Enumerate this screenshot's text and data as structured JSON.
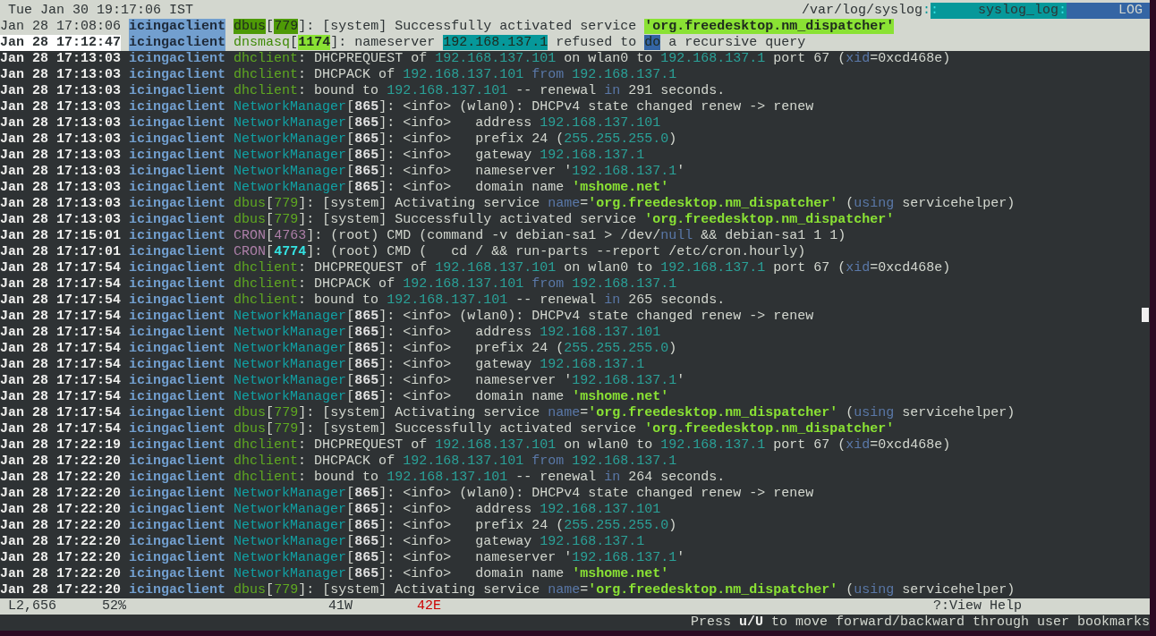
{
  "top_bar": {
    "clock": "Tue Jan 30 19:17:06 IST",
    "file_path": "/var/log/syslog",
    "separators": [
      ":",
      ":",
      ":"
    ],
    "format": "syslog_log",
    "view": "LOG"
  },
  "lines": [
    {
      "time": "Jan 28 17:08:06",
      "host": "icingaclient",
      "inverse": true,
      "selected": false,
      "segments": [
        {
          "kind": "green",
          "text": "dbus"
        },
        {
          "kind": "plain",
          "text": "["
        },
        {
          "kind": "green",
          "text": "779"
        },
        {
          "kind": "plain",
          "text": "]: [system] Successfully activated service "
        },
        {
          "kind": "string",
          "text": "'org.freedesktop.nm_dispatcher'"
        }
      ]
    },
    {
      "time": "Jan 28 17:12:47",
      "host": "icingaclient",
      "inverse": true,
      "selected": true,
      "segments": [
        {
          "kind": "green",
          "text": "dnsmasq"
        },
        {
          "kind": "plain",
          "text": "["
        },
        {
          "kind": "bright",
          "text": "1174"
        },
        {
          "kind": "plain",
          "text": "]: nameserver "
        },
        {
          "kind": "ip",
          "text": "192.168.137.1"
        },
        {
          "kind": "plain",
          "text": " refused to "
        },
        {
          "kind": "match",
          "text": "do"
        },
        {
          "kind": "plain",
          "text": " a recursive query"
        }
      ]
    },
    {
      "time": "Jan 28 17:13:03",
      "host": "icingaclient",
      "inverse": false,
      "selected": false,
      "segments": [
        {
          "kind": "green",
          "text": "dhclient"
        },
        {
          "kind": "plain",
          "text": ": DHCPREQUEST of "
        },
        {
          "kind": "ip",
          "text": "192.168.137.101"
        },
        {
          "kind": "plain",
          "text": " on wlan0 to "
        },
        {
          "kind": "ip",
          "text": "192.168.137.1"
        },
        {
          "kind": "plain",
          "text": " port 67 ("
        },
        {
          "kind": "keyword",
          "text": "xid"
        },
        {
          "kind": "plain",
          "text": "=0xcd468e)"
        }
      ]
    },
    {
      "time": "Jan 28 17:13:03",
      "host": "icingaclient",
      "inverse": false,
      "selected": false,
      "segments": [
        {
          "kind": "green",
          "text": "dhclient"
        },
        {
          "kind": "plain",
          "text": ": DHCPACK of "
        },
        {
          "kind": "ip",
          "text": "192.168.137.101"
        },
        {
          "kind": "keyword",
          "text": " from "
        },
        {
          "kind": "ip",
          "text": "192.168.137.1"
        }
      ]
    },
    {
      "time": "Jan 28 17:13:03",
      "host": "icingaclient",
      "inverse": false,
      "selected": false,
      "segments": [
        {
          "kind": "green",
          "text": "dhclient"
        },
        {
          "kind": "plain",
          "text": ": bound to "
        },
        {
          "kind": "ip",
          "text": "192.168.137.101"
        },
        {
          "kind": "plain",
          "text": " -- renewal "
        },
        {
          "kind": "keyword",
          "text": "in"
        },
        {
          "kind": "plain",
          "text": " 291 seconds."
        }
      ]
    },
    {
      "time": "Jan 28 17:13:03",
      "host": "icingaclient",
      "inverse": false,
      "selected": false,
      "segments": [
        {
          "kind": "teal",
          "text": "NetworkManager"
        },
        {
          "kind": "plain",
          "text": "["
        },
        {
          "kind": "bold",
          "text": "865"
        },
        {
          "kind": "plain",
          "text": "]: <info> (wlan0): DHCPv4 state changed renew -> renew"
        }
      ]
    },
    {
      "time": "Jan 28 17:13:03",
      "host": "icingaclient",
      "inverse": false,
      "selected": false,
      "segments": [
        {
          "kind": "teal",
          "text": "NetworkManager"
        },
        {
          "kind": "plain",
          "text": "["
        },
        {
          "kind": "bold",
          "text": "865"
        },
        {
          "kind": "plain",
          "text": "]: <info>   address "
        },
        {
          "kind": "ip",
          "text": "192.168.137.101"
        }
      ]
    },
    {
      "time": "Jan 28 17:13:03",
      "host": "icingaclient",
      "inverse": false,
      "selected": false,
      "segments": [
        {
          "kind": "teal",
          "text": "NetworkManager"
        },
        {
          "kind": "plain",
          "text": "["
        },
        {
          "kind": "bold",
          "text": "865"
        },
        {
          "kind": "plain",
          "text": "]: <info>   prefix 24 ("
        },
        {
          "kind": "ip",
          "text": "255.255.255.0"
        },
        {
          "kind": "plain",
          "text": ")"
        }
      ]
    },
    {
      "time": "Jan 28 17:13:03",
      "host": "icingaclient",
      "inverse": false,
      "selected": false,
      "segments": [
        {
          "kind": "teal",
          "text": "NetworkManager"
        },
        {
          "kind": "plain",
          "text": "["
        },
        {
          "kind": "bold",
          "text": "865"
        },
        {
          "kind": "plain",
          "text": "]: <info>   gateway "
        },
        {
          "kind": "ip",
          "text": "192.168.137.1"
        }
      ]
    },
    {
      "time": "Jan 28 17:13:03",
      "host": "icingaclient",
      "inverse": false,
      "selected": false,
      "segments": [
        {
          "kind": "teal",
          "text": "NetworkManager"
        },
        {
          "kind": "plain",
          "text": "["
        },
        {
          "kind": "bold",
          "text": "865"
        },
        {
          "kind": "plain",
          "text": "]: <info>   nameserver '"
        },
        {
          "kind": "ip",
          "text": "192.168.137.1"
        },
        {
          "kind": "plain",
          "text": "'"
        }
      ]
    },
    {
      "time": "Jan 28 17:13:03",
      "host": "icingaclient",
      "inverse": false,
      "selected": false,
      "segments": [
        {
          "kind": "teal",
          "text": "NetworkManager"
        },
        {
          "kind": "plain",
          "text": "["
        },
        {
          "kind": "bold",
          "text": "865"
        },
        {
          "kind": "plain",
          "text": "]: <info>   domain name "
        },
        {
          "kind": "string",
          "text": "'mshome.net'"
        }
      ]
    },
    {
      "time": "Jan 28 17:13:03",
      "host": "icingaclient",
      "inverse": false,
      "selected": false,
      "segments": [
        {
          "kind": "green",
          "text": "dbus"
        },
        {
          "kind": "plain",
          "text": "["
        },
        {
          "kind": "green",
          "text": "779"
        },
        {
          "kind": "plain",
          "text": "]: [system] Activating service "
        },
        {
          "kind": "keyword",
          "text": "name"
        },
        {
          "kind": "plain",
          "text": "="
        },
        {
          "kind": "string",
          "text": "'org.freedesktop.nm_dispatcher'"
        },
        {
          "kind": "plain",
          "text": " ("
        },
        {
          "kind": "keyword",
          "text": "using"
        },
        {
          "kind": "plain",
          "text": " servicehelper)"
        }
      ]
    },
    {
      "time": "Jan 28 17:13:03",
      "host": "icingaclient",
      "inverse": false,
      "selected": false,
      "segments": [
        {
          "kind": "green",
          "text": "dbus"
        },
        {
          "kind": "plain",
          "text": "["
        },
        {
          "kind": "green",
          "text": "779"
        },
        {
          "kind": "plain",
          "text": "]: [system] Successfully activated service "
        },
        {
          "kind": "string",
          "text": "'org.freedesktop.nm_dispatcher'"
        }
      ]
    },
    {
      "time": "Jan 28 17:15:01",
      "host": "icingaclient",
      "inverse": false,
      "selected": false,
      "segments": [
        {
          "kind": "pink",
          "text": "CRON"
        },
        {
          "kind": "plain",
          "text": "["
        },
        {
          "kind": "pink",
          "text": "4763"
        },
        {
          "kind": "plain",
          "text": "]: (root) CMD (command -v debian-sa1 > /dev/"
        },
        {
          "kind": "keyword",
          "text": "null"
        },
        {
          "kind": "plain",
          "text": " && debian-sa1 1 1)"
        }
      ]
    },
    {
      "time": "Jan 28 17:17:01",
      "host": "icingaclient",
      "inverse": false,
      "selected": false,
      "segments": [
        {
          "kind": "pink",
          "text": "CRON"
        },
        {
          "kind": "plain",
          "text": "["
        },
        {
          "kind": "cyan",
          "text": "4774"
        },
        {
          "kind": "plain",
          "text": "]: (root) CMD (   cd / && run-parts --report /etc/cron.hourly)"
        }
      ]
    },
    {
      "time": "Jan 28 17:17:54",
      "host": "icingaclient",
      "inverse": false,
      "selected": false,
      "segments": [
        {
          "kind": "green",
          "text": "dhclient"
        },
        {
          "kind": "plain",
          "text": ": DHCPREQUEST of "
        },
        {
          "kind": "ip",
          "text": "192.168.137.101"
        },
        {
          "kind": "plain",
          "text": " on wlan0 to "
        },
        {
          "kind": "ip",
          "text": "192.168.137.1"
        },
        {
          "kind": "plain",
          "text": " port 67 ("
        },
        {
          "kind": "keyword",
          "text": "xid"
        },
        {
          "kind": "plain",
          "text": "=0xcd468e)"
        }
      ]
    },
    {
      "time": "Jan 28 17:17:54",
      "host": "icingaclient",
      "inverse": false,
      "selected": false,
      "segments": [
        {
          "kind": "green",
          "text": "dhclient"
        },
        {
          "kind": "plain",
          "text": ": DHCPACK of "
        },
        {
          "kind": "ip",
          "text": "192.168.137.101"
        },
        {
          "kind": "keyword",
          "text": " from "
        },
        {
          "kind": "ip",
          "text": "192.168.137.1"
        }
      ]
    },
    {
      "time": "Jan 28 17:17:54",
      "host": "icingaclient",
      "inverse": false,
      "selected": false,
      "segments": [
        {
          "kind": "green",
          "text": "dhclient"
        },
        {
          "kind": "plain",
          "text": ": bound to "
        },
        {
          "kind": "ip",
          "text": "192.168.137.101"
        },
        {
          "kind": "plain",
          "text": " -- renewal "
        },
        {
          "kind": "keyword",
          "text": "in"
        },
        {
          "kind": "plain",
          "text": " 265 seconds."
        }
      ]
    },
    {
      "time": "Jan 28 17:17:54",
      "host": "icingaclient",
      "inverse": false,
      "selected": false,
      "segments": [
        {
          "kind": "teal",
          "text": "NetworkManager"
        },
        {
          "kind": "plain",
          "text": "["
        },
        {
          "kind": "bold",
          "text": "865"
        },
        {
          "kind": "plain",
          "text": "]: <info> (wlan0): DHCPv4 state changed renew -> renew"
        }
      ]
    },
    {
      "time": "Jan 28 17:17:54",
      "host": "icingaclient",
      "inverse": false,
      "selected": false,
      "segments": [
        {
          "kind": "teal",
          "text": "NetworkManager"
        },
        {
          "kind": "plain",
          "text": "["
        },
        {
          "kind": "bold",
          "text": "865"
        },
        {
          "kind": "plain",
          "text": "]: <info>   address "
        },
        {
          "kind": "ip",
          "text": "192.168.137.101"
        }
      ]
    },
    {
      "time": "Jan 28 17:17:54",
      "host": "icingaclient",
      "inverse": false,
      "selected": false,
      "segments": [
        {
          "kind": "teal",
          "text": "NetworkManager"
        },
        {
          "kind": "plain",
          "text": "["
        },
        {
          "kind": "bold",
          "text": "865"
        },
        {
          "kind": "plain",
          "text": "]: <info>   prefix 24 ("
        },
        {
          "kind": "ip",
          "text": "255.255.255.0"
        },
        {
          "kind": "plain",
          "text": ")"
        }
      ]
    },
    {
      "time": "Jan 28 17:17:54",
      "host": "icingaclient",
      "inverse": false,
      "selected": false,
      "segments": [
        {
          "kind": "teal",
          "text": "NetworkManager"
        },
        {
          "kind": "plain",
          "text": "["
        },
        {
          "kind": "bold",
          "text": "865"
        },
        {
          "kind": "plain",
          "text": "]: <info>   gateway "
        },
        {
          "kind": "ip",
          "text": "192.168.137.1"
        }
      ]
    },
    {
      "time": "Jan 28 17:17:54",
      "host": "icingaclient",
      "inverse": false,
      "selected": false,
      "segments": [
        {
          "kind": "teal",
          "text": "NetworkManager"
        },
        {
          "kind": "plain",
          "text": "["
        },
        {
          "kind": "bold",
          "text": "865"
        },
        {
          "kind": "plain",
          "text": "]: <info>   nameserver '"
        },
        {
          "kind": "ip",
          "text": "192.168.137.1"
        },
        {
          "kind": "plain",
          "text": "'"
        }
      ]
    },
    {
      "time": "Jan 28 17:17:54",
      "host": "icingaclient",
      "inverse": false,
      "selected": false,
      "segments": [
        {
          "kind": "teal",
          "text": "NetworkManager"
        },
        {
          "kind": "plain",
          "text": "["
        },
        {
          "kind": "bold",
          "text": "865"
        },
        {
          "kind": "plain",
          "text": "]: <info>   domain name "
        },
        {
          "kind": "string",
          "text": "'mshome.net'"
        }
      ]
    },
    {
      "time": "Jan 28 17:17:54",
      "host": "icingaclient",
      "inverse": false,
      "selected": false,
      "segments": [
        {
          "kind": "green",
          "text": "dbus"
        },
        {
          "kind": "plain",
          "text": "["
        },
        {
          "kind": "green",
          "text": "779"
        },
        {
          "kind": "plain",
          "text": "]: [system] Activating service "
        },
        {
          "kind": "keyword",
          "text": "name"
        },
        {
          "kind": "plain",
          "text": "="
        },
        {
          "kind": "string",
          "text": "'org.freedesktop.nm_dispatcher'"
        },
        {
          "kind": "plain",
          "text": " ("
        },
        {
          "kind": "keyword",
          "text": "using"
        },
        {
          "kind": "plain",
          "text": " servicehelper)"
        }
      ]
    },
    {
      "time": "Jan 28 17:17:54",
      "host": "icingaclient",
      "inverse": false,
      "selected": false,
      "segments": [
        {
          "kind": "green",
          "text": "dbus"
        },
        {
          "kind": "plain",
          "text": "["
        },
        {
          "kind": "green",
          "text": "779"
        },
        {
          "kind": "plain",
          "text": "]: [system] Successfully activated service "
        },
        {
          "kind": "string",
          "text": "'org.freedesktop.nm_dispatcher'"
        }
      ]
    },
    {
      "time": "Jan 28 17:22:19",
      "host": "icingaclient",
      "inverse": false,
      "selected": false,
      "segments": [
        {
          "kind": "green",
          "text": "dhclient"
        },
        {
          "kind": "plain",
          "text": ": DHCPREQUEST of "
        },
        {
          "kind": "ip",
          "text": "192.168.137.101"
        },
        {
          "kind": "plain",
          "text": " on wlan0 to "
        },
        {
          "kind": "ip",
          "text": "192.168.137.1"
        },
        {
          "kind": "plain",
          "text": " port 67 ("
        },
        {
          "kind": "keyword",
          "text": "xid"
        },
        {
          "kind": "plain",
          "text": "=0xcd468e)"
        }
      ]
    },
    {
      "time": "Jan 28 17:22:20",
      "host": "icingaclient",
      "inverse": false,
      "selected": false,
      "segments": [
        {
          "kind": "green",
          "text": "dhclient"
        },
        {
          "kind": "plain",
          "text": ": DHCPACK of "
        },
        {
          "kind": "ip",
          "text": "192.168.137.101"
        },
        {
          "kind": "keyword",
          "text": " from "
        },
        {
          "kind": "ip",
          "text": "192.168.137.1"
        }
      ]
    },
    {
      "time": "Jan 28 17:22:20",
      "host": "icingaclient",
      "inverse": false,
      "selected": false,
      "segments": [
        {
          "kind": "green",
          "text": "dhclient"
        },
        {
          "kind": "plain",
          "text": ": bound to "
        },
        {
          "kind": "ip",
          "text": "192.168.137.101"
        },
        {
          "kind": "plain",
          "text": " -- renewal "
        },
        {
          "kind": "keyword",
          "text": "in"
        },
        {
          "kind": "plain",
          "text": " 264 seconds."
        }
      ]
    },
    {
      "time": "Jan 28 17:22:20",
      "host": "icingaclient",
      "inverse": false,
      "selected": false,
      "segments": [
        {
          "kind": "teal",
          "text": "NetworkManager"
        },
        {
          "kind": "plain",
          "text": "["
        },
        {
          "kind": "bold",
          "text": "865"
        },
        {
          "kind": "plain",
          "text": "]: <info> (wlan0): DHCPv4 state changed renew -> renew"
        }
      ]
    },
    {
      "time": "Jan 28 17:22:20",
      "host": "icingaclient",
      "inverse": false,
      "selected": false,
      "segments": [
        {
          "kind": "teal",
          "text": "NetworkManager"
        },
        {
          "kind": "plain",
          "text": "["
        },
        {
          "kind": "bold",
          "text": "865"
        },
        {
          "kind": "plain",
          "text": "]: <info>   address "
        },
        {
          "kind": "ip",
          "text": "192.168.137.101"
        }
      ]
    },
    {
      "time": "Jan 28 17:22:20",
      "host": "icingaclient",
      "inverse": false,
      "selected": false,
      "segments": [
        {
          "kind": "teal",
          "text": "NetworkManager"
        },
        {
          "kind": "plain",
          "text": "["
        },
        {
          "kind": "bold",
          "text": "865"
        },
        {
          "kind": "plain",
          "text": "]: <info>   prefix 24 ("
        },
        {
          "kind": "ip",
          "text": "255.255.255.0"
        },
        {
          "kind": "plain",
          "text": ")"
        }
      ]
    },
    {
      "time": "Jan 28 17:22:20",
      "host": "icingaclient",
      "inverse": false,
      "selected": false,
      "segments": [
        {
          "kind": "teal",
          "text": "NetworkManager"
        },
        {
          "kind": "plain",
          "text": "["
        },
        {
          "kind": "bold",
          "text": "865"
        },
        {
          "kind": "plain",
          "text": "]: <info>   gateway "
        },
        {
          "kind": "ip",
          "text": "192.168.137.1"
        }
      ]
    },
    {
      "time": "Jan 28 17:22:20",
      "host": "icingaclient",
      "inverse": false,
      "selected": false,
      "segments": [
        {
          "kind": "teal",
          "text": "NetworkManager"
        },
        {
          "kind": "plain",
          "text": "["
        },
        {
          "kind": "bold",
          "text": "865"
        },
        {
          "kind": "plain",
          "text": "]: <info>   nameserver '"
        },
        {
          "kind": "ip",
          "text": "192.168.137.1"
        },
        {
          "kind": "plain",
          "text": "'"
        }
      ]
    },
    {
      "time": "Jan 28 17:22:20",
      "host": "icingaclient",
      "inverse": false,
      "selected": false,
      "segments": [
        {
          "kind": "teal",
          "text": "NetworkManager"
        },
        {
          "kind": "plain",
          "text": "["
        },
        {
          "kind": "bold",
          "text": "865"
        },
        {
          "kind": "plain",
          "text": "]: <info>   domain name "
        },
        {
          "kind": "string",
          "text": "'mshome.net'"
        }
      ]
    },
    {
      "time": "Jan 28 17:22:20",
      "host": "icingaclient",
      "inverse": false,
      "selected": false,
      "segments": [
        {
          "kind": "green",
          "text": "dbus"
        },
        {
          "kind": "plain",
          "text": "["
        },
        {
          "kind": "green",
          "text": "779"
        },
        {
          "kind": "plain",
          "text": "]: [system] Activating service "
        },
        {
          "kind": "keyword",
          "text": "name"
        },
        {
          "kind": "plain",
          "text": "="
        },
        {
          "kind": "string",
          "text": "'org.freedesktop.nm_dispatcher'"
        },
        {
          "kind": "plain",
          "text": " ("
        },
        {
          "kind": "keyword",
          "text": "using"
        },
        {
          "kind": "plain",
          "text": " servicehelper)"
        }
      ]
    }
  ],
  "status_bar": {
    "line": "L2,656",
    "percent": "52%",
    "warnings": "41W",
    "errors": "42E",
    "help": "?:View Help"
  },
  "hint": "Press **u/U** to move forward/backward through user bookmarks"
}
